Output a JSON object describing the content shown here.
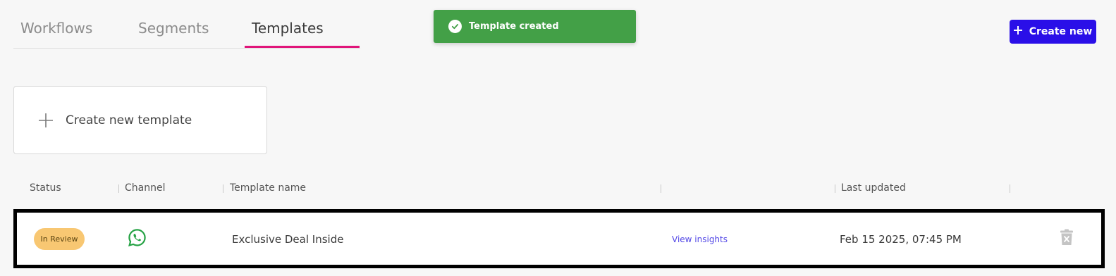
{
  "tabs": [
    {
      "label": "Workflows",
      "active": false
    },
    {
      "label": "Segments",
      "active": false
    },
    {
      "label": "Templates",
      "active": true
    }
  ],
  "toast": {
    "message": "Template created",
    "icon": "check-circle-icon",
    "color": "#43a047"
  },
  "header": {
    "create_button_label": "Create new",
    "button_color": "#2a0fe8"
  },
  "create_card": {
    "label": "Create new template"
  },
  "table": {
    "columns": [
      "Status",
      "Channel",
      "Template name",
      "",
      "Last updated"
    ],
    "rows": [
      {
        "status": "In Review",
        "channel": "whatsapp-icon",
        "name": "Exclusive Deal Inside",
        "action": "View insights",
        "last_updated": "Feb 15 2025, 07:45 PM"
      }
    ]
  },
  "colors": {
    "accent_underline": "#e0157a",
    "badge_review": "#f8c772",
    "link": "#5146e6"
  }
}
